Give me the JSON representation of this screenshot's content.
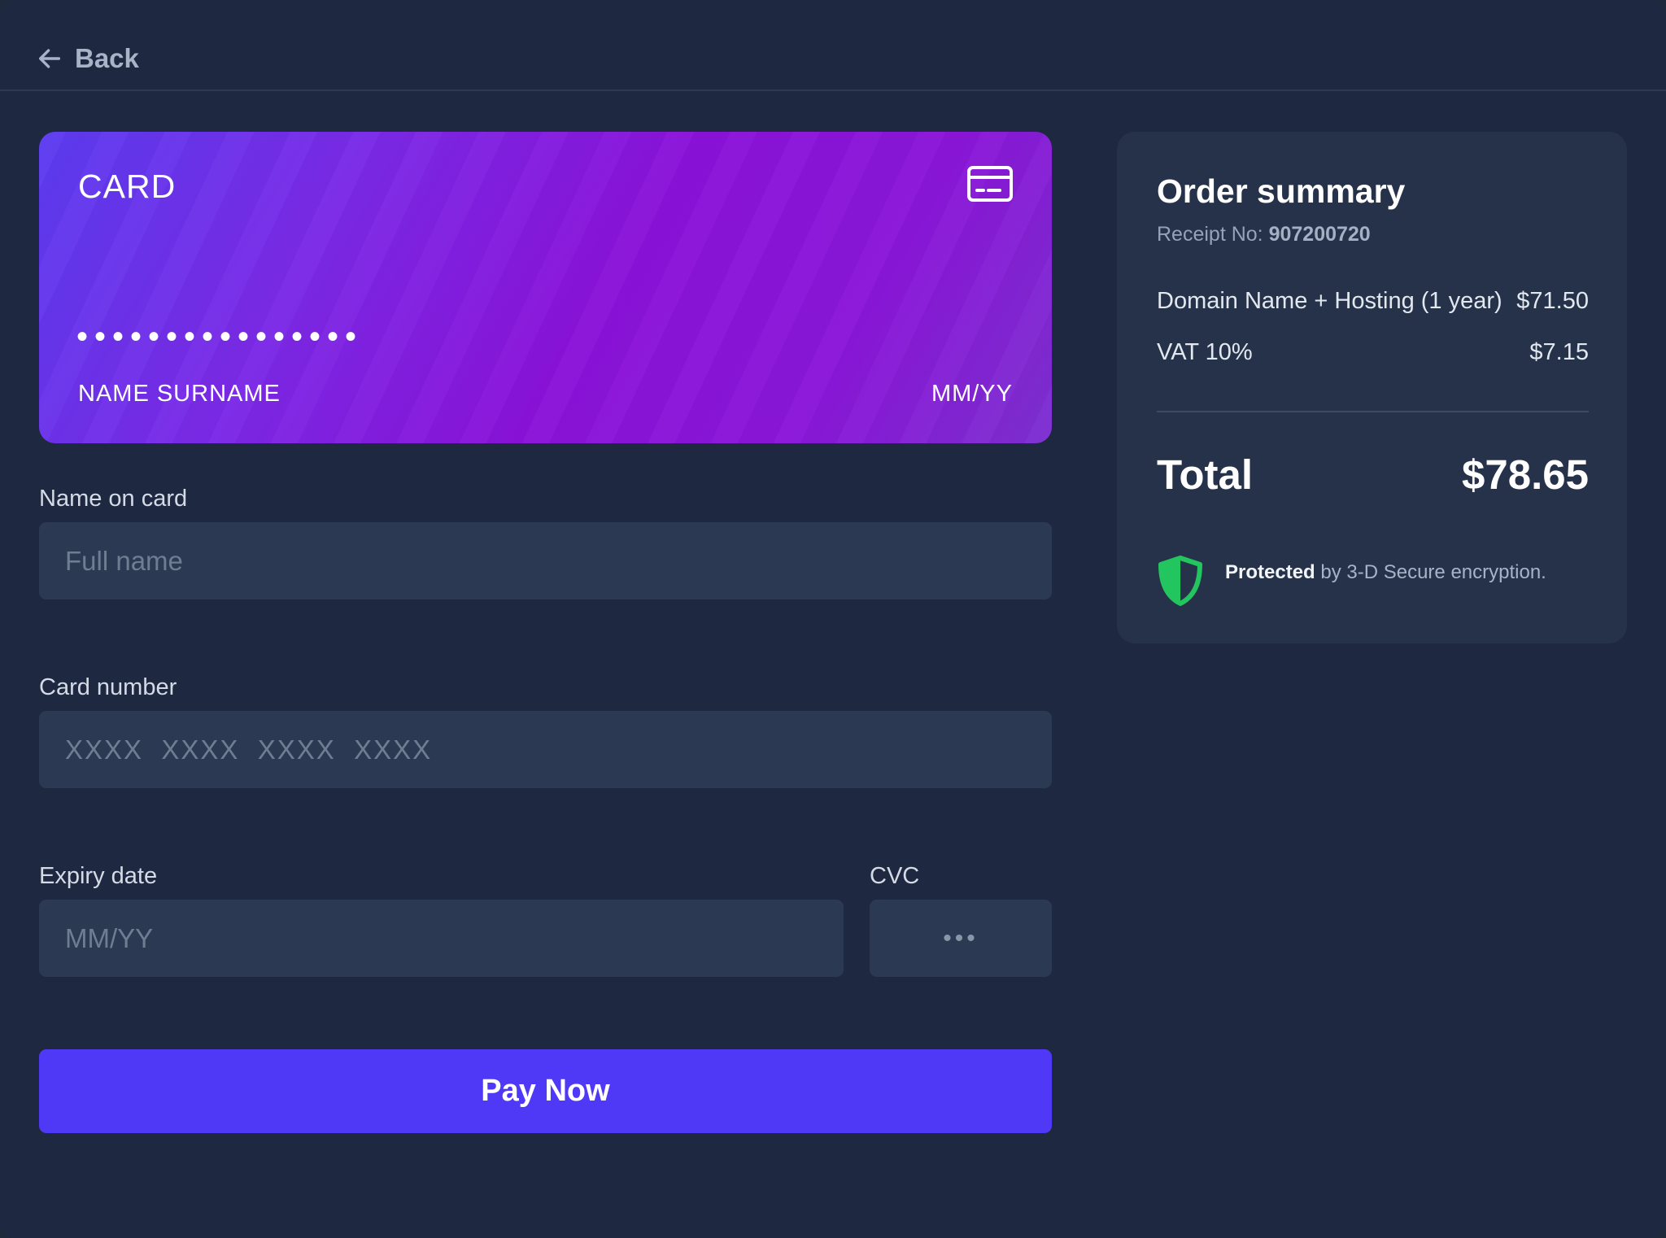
{
  "nav": {
    "back_label": "Back"
  },
  "card_preview": {
    "brand": "CARD",
    "number_masked": "••••••••••••••••",
    "name": "NAME SURNAME",
    "expiry": "MM/YY"
  },
  "form": {
    "name": {
      "label": "Name on card",
      "placeholder": "Full name",
      "value": ""
    },
    "number": {
      "label": "Card number",
      "placeholder": "XXXX  XXXX  XXXX  XXXX",
      "value": ""
    },
    "expiry": {
      "label": "Expiry date",
      "placeholder": "MM/YY",
      "value": ""
    },
    "cvc": {
      "label": "CVC",
      "placeholder": "•••"
    },
    "pay_label": "Pay Now"
  },
  "summary": {
    "title": "Order summary",
    "receipt_label": "Receipt No:",
    "receipt_number": "907200720",
    "items": [
      {
        "label": "Domain Name + Hosting (1 year)",
        "price": "$71.50"
      },
      {
        "label": "VAT 10%",
        "price": "$7.15"
      }
    ],
    "total_label": "Total",
    "total_value": "$78.65",
    "secure_strong": "Protected",
    "secure_rest": "by 3-D Secure encryption."
  },
  "colors": {
    "background": "#1e2840",
    "panel": "#253249",
    "input": "#2b3a52",
    "accent": "#4f39f6",
    "card_gradient_start": "#5b3cf0",
    "card_gradient_end": "#8a12d9",
    "shield": "#22c55e"
  },
  "icons": {
    "back": "arrow-left-icon",
    "card": "credit-card-icon",
    "secure": "shield-icon"
  }
}
